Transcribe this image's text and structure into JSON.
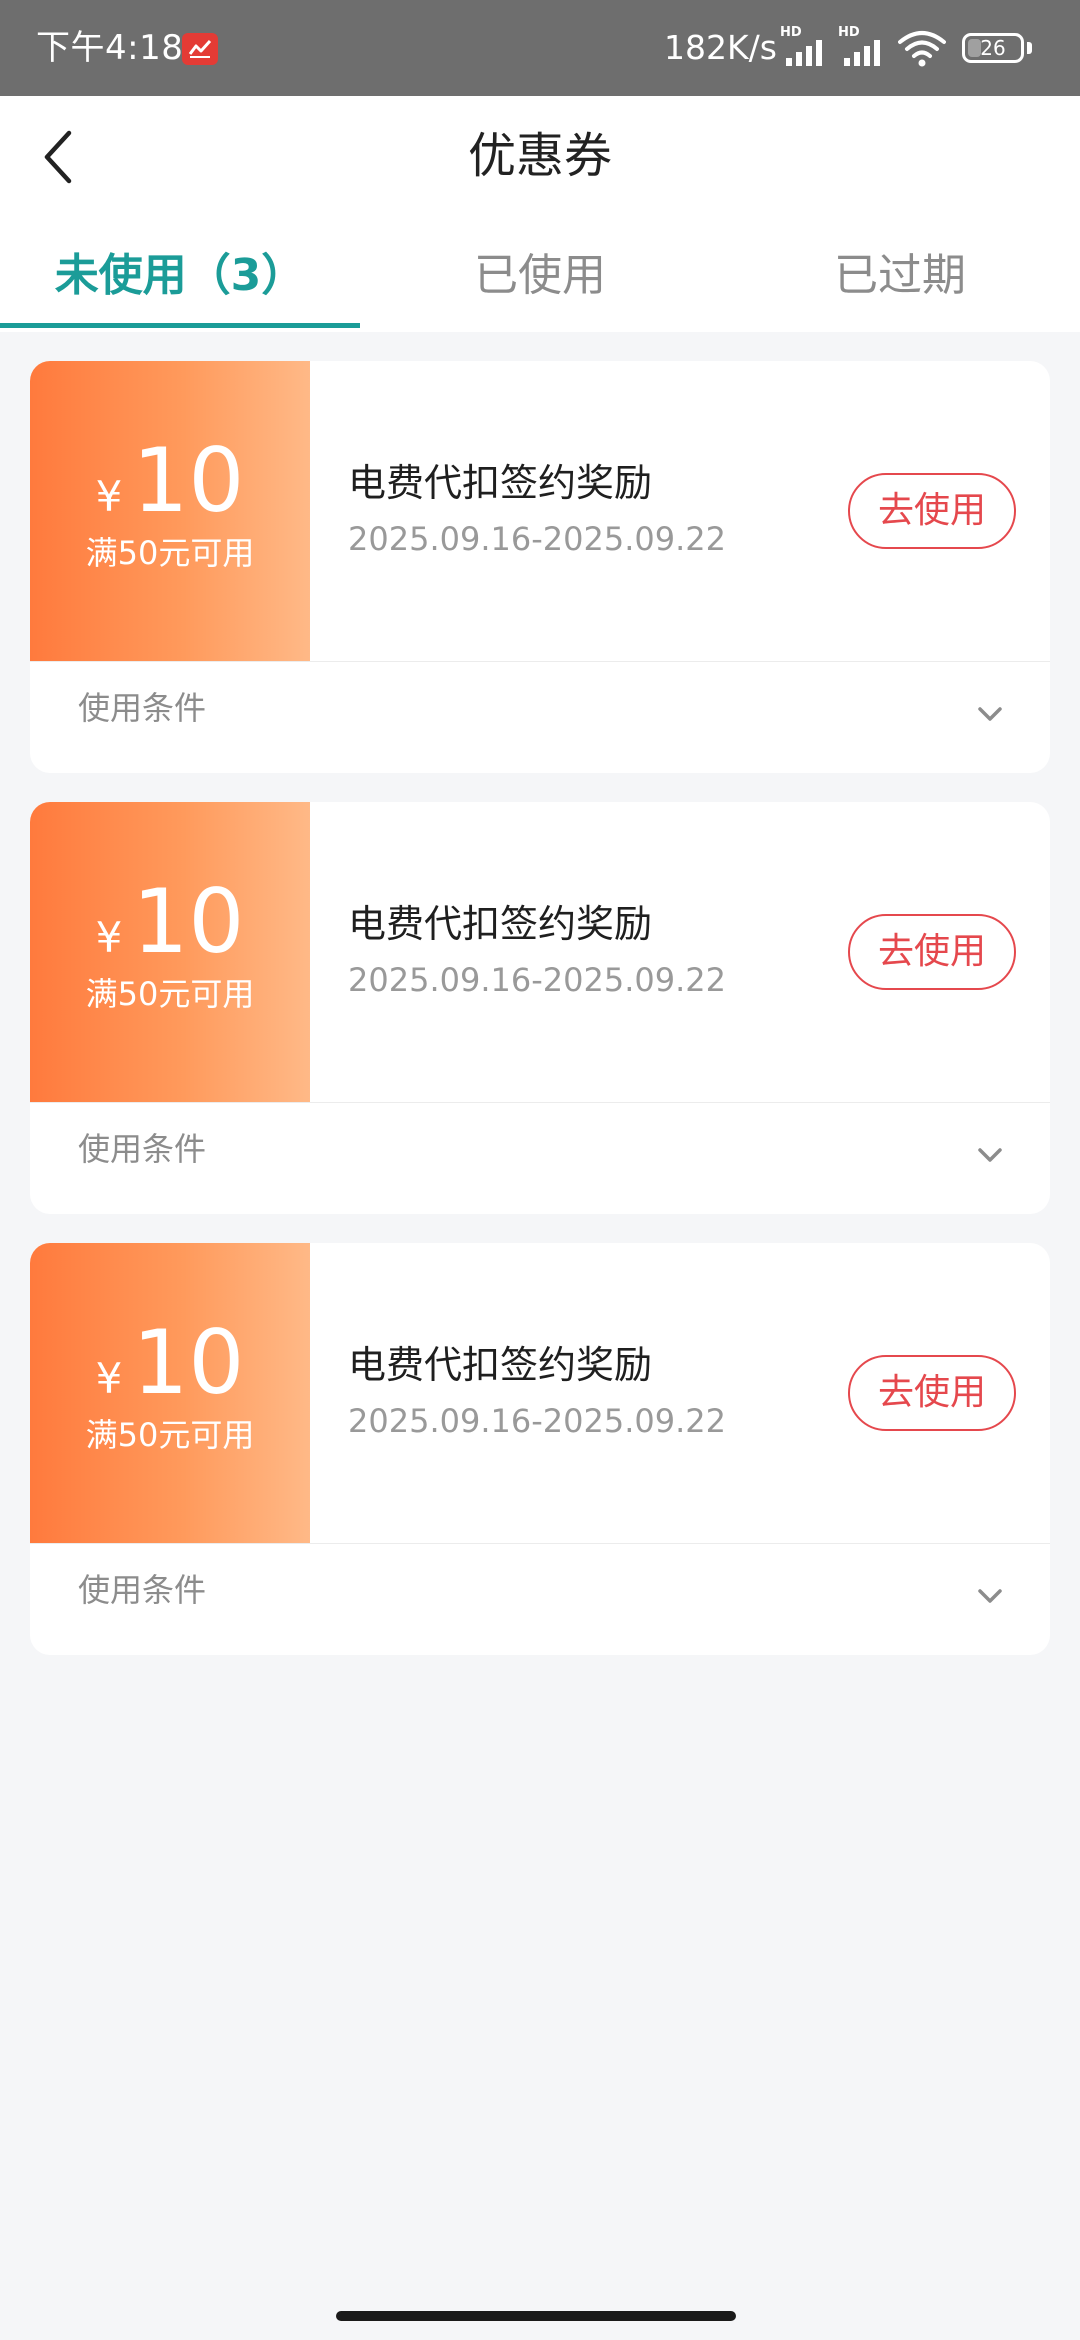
{
  "status_bar": {
    "time": "下午4:18",
    "app_icon": "stock-app-icon",
    "network_speed": "182K/s",
    "signal_label": "HD",
    "battery": "26",
    "battery_level": 0.26
  },
  "header": {
    "title": "优惠券",
    "back_icon": "chevron-left-icon"
  },
  "tabs": [
    {
      "label": "未使用（3）",
      "active": true
    },
    {
      "label": "已使用",
      "active": false
    },
    {
      "label": "已过期",
      "active": false
    }
  ],
  "colors": {
    "accent": "#1b9c98",
    "coupon_gradient_start": "#ff7a3d",
    "coupon_gradient_end": "#ffb987",
    "use_button": "#e5484d"
  },
  "coupons": [
    {
      "currency": "¥",
      "amount": "10",
      "threshold": "满50元可用",
      "title": "电费代扣签约奖励",
      "validity": "2025.09.16-2025.09.22",
      "action_label": "去使用",
      "conditions_label": "使用条件"
    },
    {
      "currency": "¥",
      "amount": "10",
      "threshold": "满50元可用",
      "title": "电费代扣签约奖励",
      "validity": "2025.09.16-2025.09.22",
      "action_label": "去使用",
      "conditions_label": "使用条件"
    },
    {
      "currency": "¥",
      "amount": "10",
      "threshold": "满50元可用",
      "title": "电费代扣签约奖励",
      "validity": "2025.09.16-2025.09.22",
      "action_label": "去使用",
      "conditions_label": "使用条件"
    }
  ]
}
